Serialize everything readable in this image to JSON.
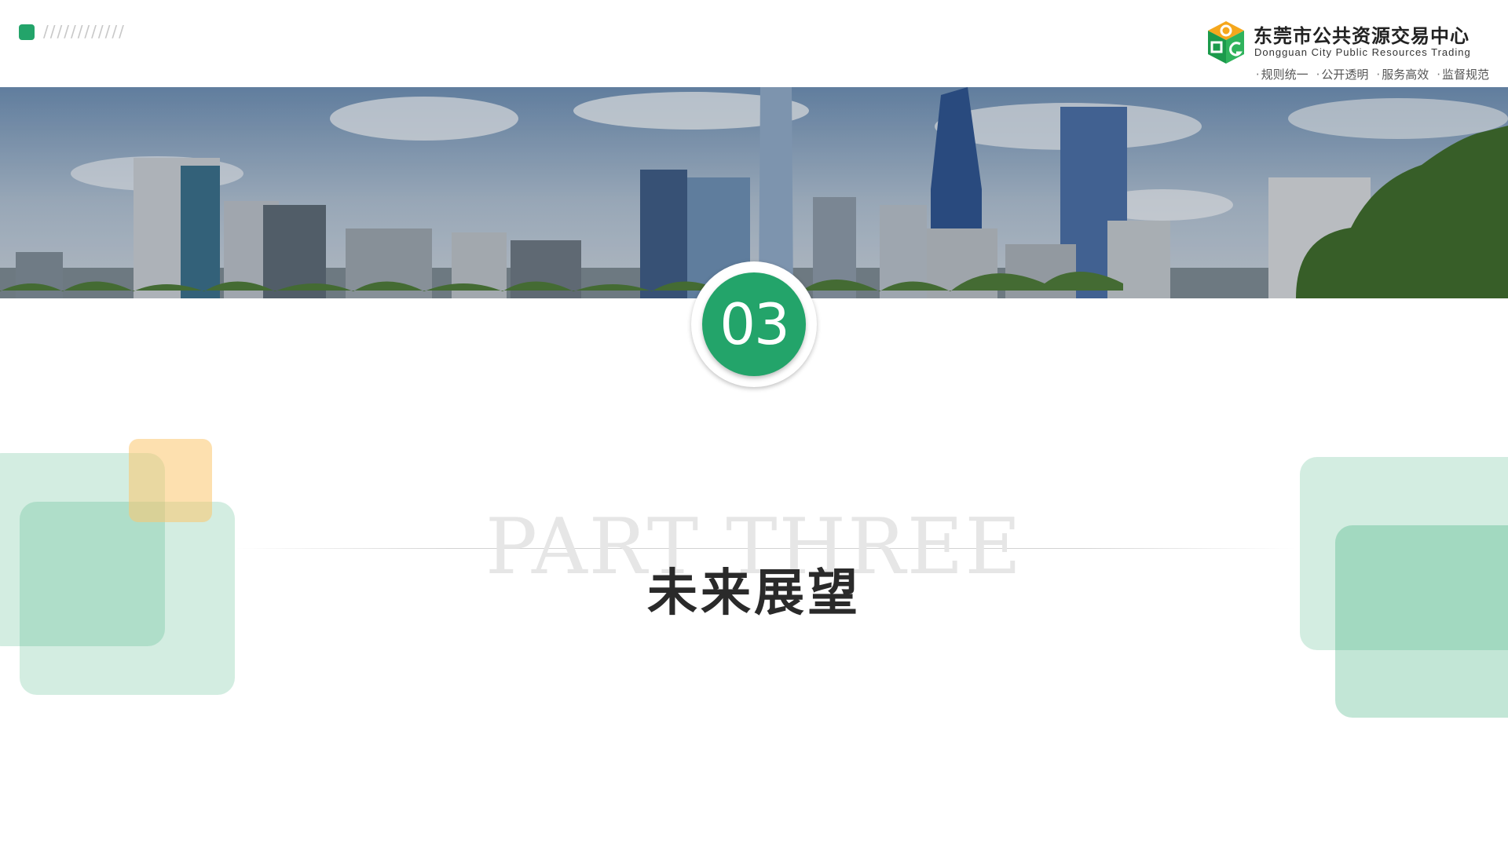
{
  "header": {
    "corner_decoration": "////////////",
    "logo": {
      "name_cn": "东莞市公共资源交易中心",
      "name_en": "Dongguan City Public Resources Trading",
      "emblem_icon": "dggzy-logo-icon"
    },
    "slogans": [
      "规则统一",
      "公开透明",
      "服务高效",
      "监督规范"
    ]
  },
  "banner": {
    "image": "city-skyline-photo"
  },
  "section": {
    "number": "03",
    "part_label": "PART THREE",
    "title": "未来展望"
  },
  "colors": {
    "accent": "#23a46a",
    "accent_light": "#d3ede2",
    "highlight": "#fcd79a",
    "title_text": "#2a2a2a",
    "watermark_text": "#e6e6e6"
  }
}
